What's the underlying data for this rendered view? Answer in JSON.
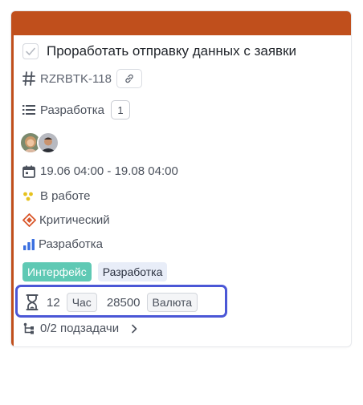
{
  "colors": {
    "header": "#c04f1c",
    "accent": "#c04f1c",
    "estimate_highlight": "#4b57d6"
  },
  "task": {
    "title": "Проработать отправку данных с заявки",
    "id": "RZRBTK-118",
    "list_name": "Разработка",
    "list_count": "1",
    "dates": "19.06 04:00 - 19.08 04:00",
    "status": "В работе",
    "priority": "Критический",
    "type": "Разработка",
    "tags": [
      "Интерфейс",
      "Разработка"
    ],
    "estimate": {
      "time_value": "12",
      "time_unit": "Час",
      "cost_value": "28500",
      "cost_unit": "Валюта"
    },
    "subtasks": "0/2 подзадачи"
  },
  "icons": {
    "checkbox": "check-icon",
    "hash": "hash-icon",
    "link": "link-icon",
    "list": "list-icon",
    "calendar": "calendar-icon",
    "status": "status-dots-icon",
    "priority": "priority-diamond-icon",
    "type": "bar-chart-icon",
    "estimate": "hourglass-icon",
    "subtasks": "subtask-tree-icon",
    "chevron": "chevron-right-icon"
  }
}
